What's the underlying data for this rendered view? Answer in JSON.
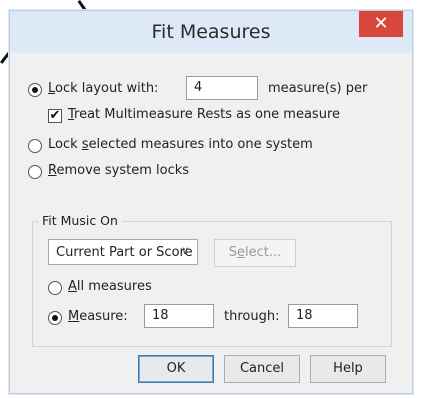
{
  "dialog": {
    "title": "Fit Measures",
    "close_glyph": "✕"
  },
  "lock_layout": {
    "label_prefix": "L",
    "label_rest": "ock layout with:",
    "value": "4",
    "suffix": "measure(s) per",
    "checked": true
  },
  "treat_multimeasure": {
    "checkmark": "✔",
    "label_prefix": "T",
    "label_rest": "reat Multimeasure Rests as one measure",
    "checked": true
  },
  "lock_selected": {
    "label_a": "Lock ",
    "label_u": "s",
    "label_b": "elected measures into one system",
    "checked": false
  },
  "remove_locks": {
    "label_u": "R",
    "label_rest": "emove system locks",
    "checked": false
  },
  "fit_music_on": {
    "group_title": "Fit Music On",
    "select_value": "Current Part or Score",
    "select_arrow": "∨",
    "select_button_a": "S",
    "select_button_u": "e",
    "select_button_b": "lect...",
    "all_measures": {
      "label_u": "A",
      "label_rest": "ll measures",
      "checked": false
    },
    "measure": {
      "label_u": "M",
      "label_rest": "easure:",
      "from_value": "18",
      "through_label": "through:",
      "to_value": "18",
      "checked": true
    }
  },
  "buttons": {
    "ok": "OK",
    "cancel": "Cancel",
    "help": "Help"
  }
}
